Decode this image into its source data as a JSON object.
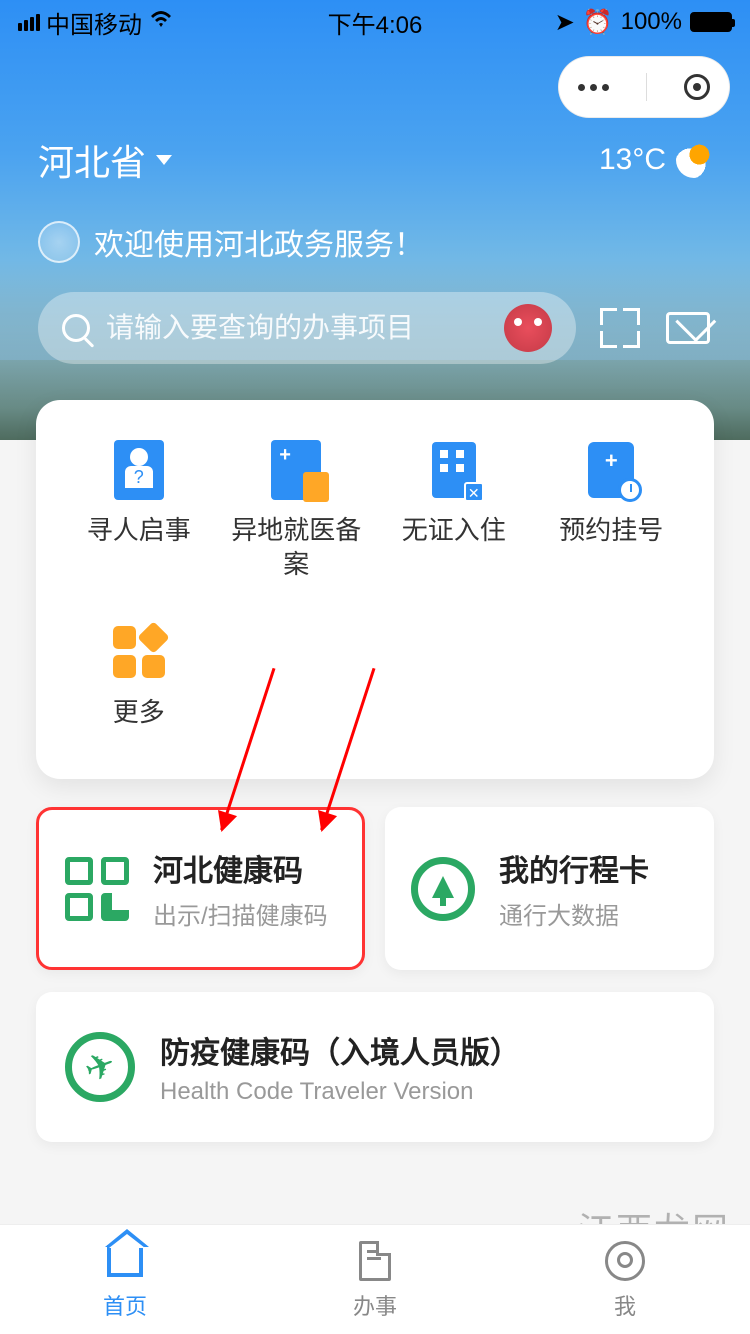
{
  "statusBar": {
    "carrier": "中国移动",
    "time": "下午4:06",
    "battery": "100%"
  },
  "location": {
    "province": "河北省",
    "temperature": "13°C"
  },
  "welcome": {
    "text": "欢迎使用河北政务服务！"
  },
  "search": {
    "placeholder": "请输入要查询的办事项目"
  },
  "services": [
    {
      "label": "寻人启事"
    },
    {
      "label": "异地就医备案"
    },
    {
      "label": "无证入住"
    },
    {
      "label": "预约挂号"
    },
    {
      "label": "更多"
    }
  ],
  "features": {
    "healthCode": {
      "title": "河北健康码",
      "subtitle": "出示/扫描健康码"
    },
    "travelCard": {
      "title": "我的行程卡",
      "subtitle": "通行大数据"
    },
    "inbound": {
      "title": "防疫健康码（入境人员版）",
      "subtitle": "Health Code Traveler Version"
    }
  },
  "tabs": {
    "home": "首页",
    "affairs": "办事",
    "me": "我"
  },
  "watermark": "江西龙网"
}
